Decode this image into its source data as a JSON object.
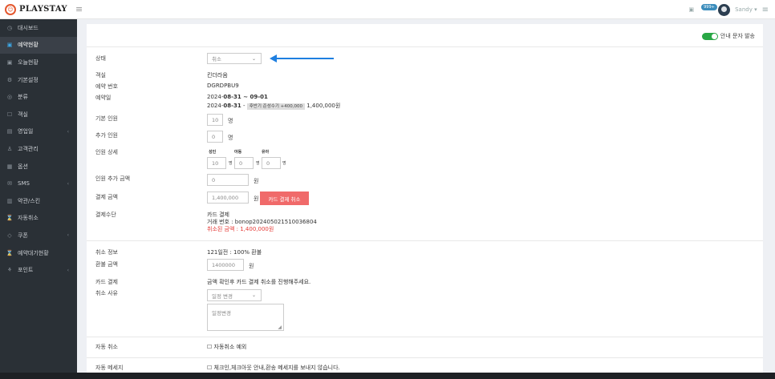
{
  "brand": {
    "name": "PLAYSTAY"
  },
  "header": {
    "badge": "999+",
    "user": "Sandy ▾"
  },
  "sidebar": {
    "items": [
      {
        "icon": "◷",
        "icon_name": "dashboard-icon",
        "label": "대시보드",
        "caret": ""
      },
      {
        "icon": "▣",
        "icon_name": "calendar-icon",
        "label": "예약현황",
        "caret": "",
        "active": true
      },
      {
        "icon": "▣",
        "icon_name": "calendar-today-icon",
        "label": "오늘현황",
        "caret": ""
      },
      {
        "icon": "⚙",
        "icon_name": "settings-icon",
        "label": "기본설정",
        "caret": ""
      },
      {
        "icon": "◎",
        "icon_name": "category-icon",
        "label": "분류",
        "caret": ""
      },
      {
        "icon": "☐",
        "icon_name": "room-icon",
        "label": "객실",
        "caret": ""
      },
      {
        "icon": "▤",
        "icon_name": "business-icon",
        "label": "영업일",
        "caret": "‹"
      },
      {
        "icon": "♙",
        "icon_name": "customer-icon",
        "label": "고객관리",
        "caret": ""
      },
      {
        "icon": "▦",
        "icon_name": "option-icon",
        "label": "옵션",
        "caret": ""
      },
      {
        "icon": "✉",
        "icon_name": "sms-icon",
        "label": "SMS",
        "caret": "‹"
      },
      {
        "icon": "▥",
        "icon_name": "terms-icon",
        "label": "약관/스킨",
        "caret": ""
      },
      {
        "icon": "⌛",
        "icon_name": "auto-cancel-icon",
        "label": "자동취소",
        "caret": ""
      },
      {
        "icon": "◇",
        "icon_name": "coupon-icon",
        "label": "쿠폰",
        "caret": "‹"
      },
      {
        "icon": "⌛",
        "icon_name": "waitlist-icon",
        "label": "예약대기현황",
        "caret": ""
      },
      {
        "icon": "⚘",
        "icon_name": "point-icon",
        "label": "포인트",
        "caret": "‹"
      }
    ]
  },
  "main": {
    "sms_toggle_label": "안내 문자 발송",
    "status": {
      "label": "상태",
      "value": "취소"
    },
    "room": {
      "label": "객실",
      "value": "킨더라움"
    },
    "reservation_no": {
      "label": "예약 번호",
      "value": "DGRDPBU9"
    },
    "reservation_date": {
      "label": "예약일",
      "line1_prefix": "2024-",
      "line1_bold": "08-31 ~ 09-01",
      "line2_prefix": "2024-",
      "line2_bold": "08-31",
      "line2_sep": " - ",
      "tag": "후반기 준성수기 +400,000",
      "price": "1,400,000원"
    },
    "base_guests": {
      "label": "기본 인원",
      "value": "10",
      "unit": "명"
    },
    "extra_guests": {
      "label": "추가 인원",
      "value": "0",
      "unit": "명"
    },
    "guest_detail": {
      "label": "인원 상세",
      "adult_h": "성인",
      "child_h": "아동",
      "infant_h": "유아",
      "adult": "10",
      "child": "0",
      "infant": "0",
      "unit": "명"
    },
    "extra_fee": {
      "label": "인원 추가 금액",
      "value": "0",
      "unit": "원"
    },
    "payment_amount": {
      "label": "결제 금액",
      "value": "1,400,000",
      "unit": "원",
      "button": "카드 결제 취소"
    },
    "payment_method": {
      "label": "결제수단",
      "line1": "카드 결제",
      "line2": "거래 번호 : bonop20240502151003680​4",
      "line3": "취소된 금액 : 1,400,000원"
    },
    "cancel_info": {
      "label": "취소 정보",
      "value": "121일전 : 100% 환불"
    },
    "refund_amount": {
      "label": "환불 금액",
      "value": "1400000",
      "unit": "원"
    },
    "card_payment": {
      "label": "카드 결제",
      "value": "금액 확인후 카드 결제 취소를 진행해주세요."
    },
    "cancel_reason": {
      "label": "취소 사유",
      "select": "일정 변경",
      "textarea": "일정변경"
    },
    "auto_cancel": {
      "label": "자동 취소",
      "checkbox_label": "☐ 자동취소 예외"
    },
    "auto_message": {
      "label": "자동 메세지",
      "checkbox_label": "☐ 체크인,체크아웃 안내,환송 메세지를 보내지 않습니다."
    }
  },
  "colors": {
    "accent": "#1e7fe0",
    "sidebar": "#2a3036",
    "danger": "#f06a6a",
    "toggle": "#28a745"
  }
}
